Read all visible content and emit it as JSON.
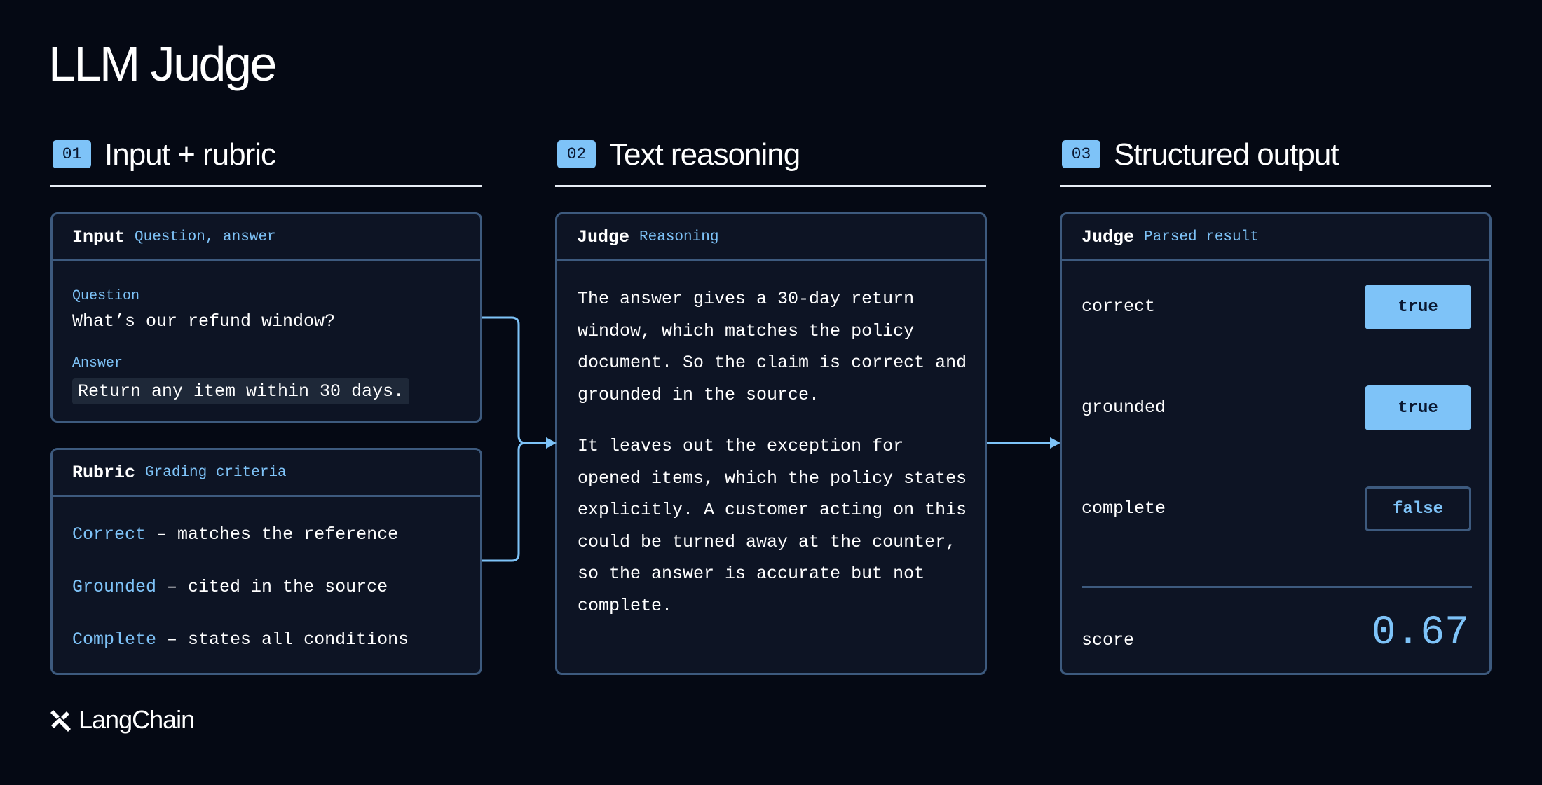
{
  "title": "LLM Judge",
  "columns": [
    {
      "num": "01",
      "label": "Input + rubric"
    },
    {
      "num": "02",
      "label": "Text reasoning"
    },
    {
      "num": "03",
      "label": "Structured output"
    }
  ],
  "input_card": {
    "title": "Input",
    "subtitle": "Question, answer",
    "question_label": "Question",
    "question": "What’s our refund window?",
    "answer_label": "Answer",
    "answer": "Return any item within 30 days."
  },
  "rubric_card": {
    "title": "Rubric",
    "subtitle": "Grading criteria",
    "items": [
      {
        "criterion": "Correct",
        "description": " – matches the reference"
      },
      {
        "criterion": "Grounded",
        "description": " – cited in the source"
      },
      {
        "criterion": "Complete",
        "description": " – states all conditions"
      }
    ]
  },
  "reasoning_card": {
    "title": "Judge",
    "subtitle": "Reasoning",
    "paragraph_1": "The answer gives a 30-day return window, which matches the policy document. So the claim is correct and grounded in the source.",
    "paragraph_2": "It leaves out the exception for opened items, which the policy states explicitly. A customer acting on this could be turned away at the counter, so the answer is accurate but not complete."
  },
  "output_card": {
    "title": "Judge",
    "subtitle": "Parsed result",
    "rows": [
      {
        "label": "correct",
        "value": "true"
      },
      {
        "label": "grounded",
        "value": "true"
      },
      {
        "label": "complete",
        "value": "false"
      }
    ],
    "score_label": "score",
    "score_value": "0.67"
  },
  "brand": {
    "name": "LangChain"
  },
  "colors": {
    "background": "#050914",
    "accent": "#7ec3f8",
    "border": "#3d5a7e",
    "card": "#0d1424"
  }
}
